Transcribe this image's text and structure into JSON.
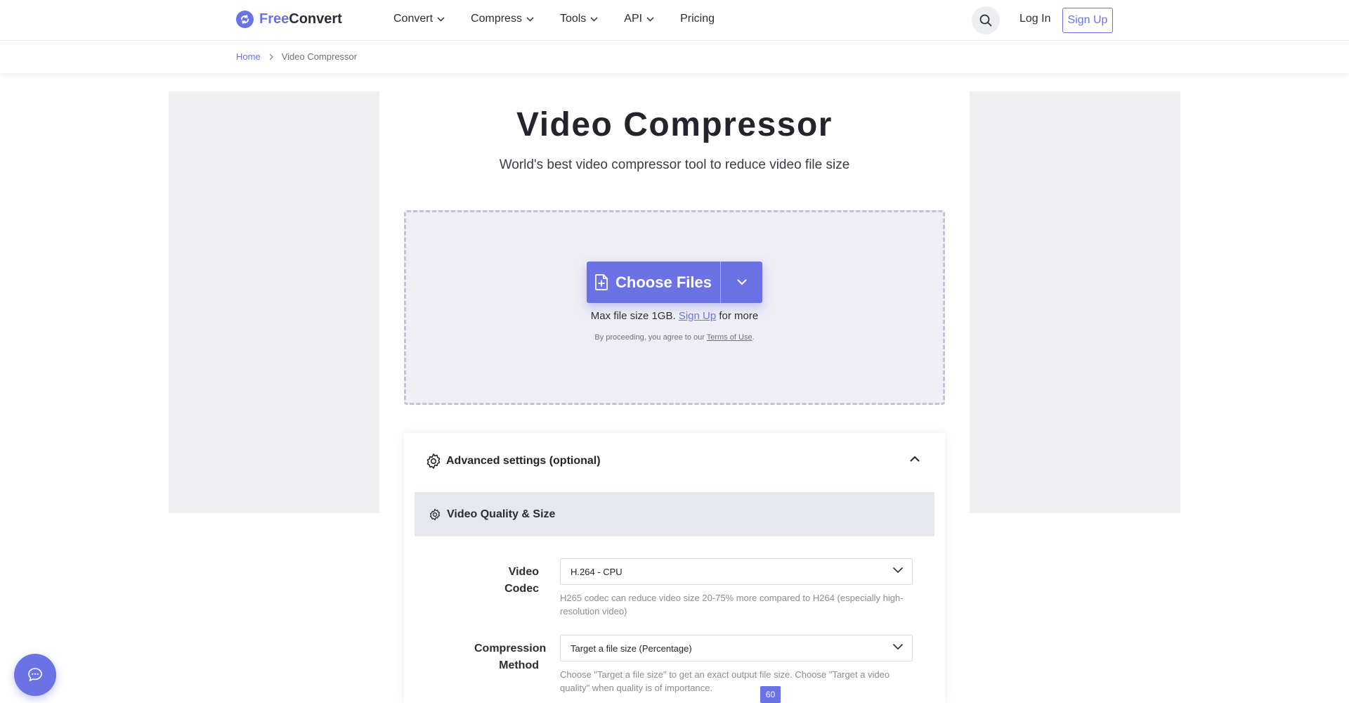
{
  "brand": {
    "part1": "Free",
    "part2": "Convert",
    "icon": "refresh-logo-icon",
    "accent": "#6a72e6"
  },
  "nav": {
    "items": [
      {
        "label": "Convert",
        "dropdown": true
      },
      {
        "label": "Compress",
        "dropdown": true
      },
      {
        "label": "Tools",
        "dropdown": true
      },
      {
        "label": "API",
        "dropdown": true
      },
      {
        "label": "Pricing",
        "dropdown": false
      }
    ],
    "login": "Log In",
    "signup": "Sign Up"
  },
  "breadcrumb": {
    "home": "Home",
    "current": "Video Compressor"
  },
  "hero": {
    "title": "Video Compressor",
    "subtitle": "World's best video compressor tool to reduce video file size"
  },
  "upload": {
    "button_label": "Choose Files",
    "max_prefix": "Max file size 1GB.",
    "max_link": "Sign Up",
    "max_suffix": "for more",
    "terms_prefix": "By proceeding, you agree to our",
    "terms_link": "Terms of Use",
    "terms_suffix": "."
  },
  "advanced": {
    "title": "Advanced settings (optional)",
    "section_title": "Video Quality & Size",
    "codec_label": "Video Codec",
    "codec_value": "H.264 - CPU",
    "codec_hint": "H265 codec can reduce video size 20-75% more compared to H264 (especially high-resolution video)",
    "method_label_1": "Compression",
    "method_label_2": "Method",
    "method_value": "Target a file size (Percentage)",
    "method_hint": "Choose \"Target a file size\" to get an exact output file size. Choose \"Target a video quality\" when quality is of importance.",
    "slider_value": "60"
  }
}
